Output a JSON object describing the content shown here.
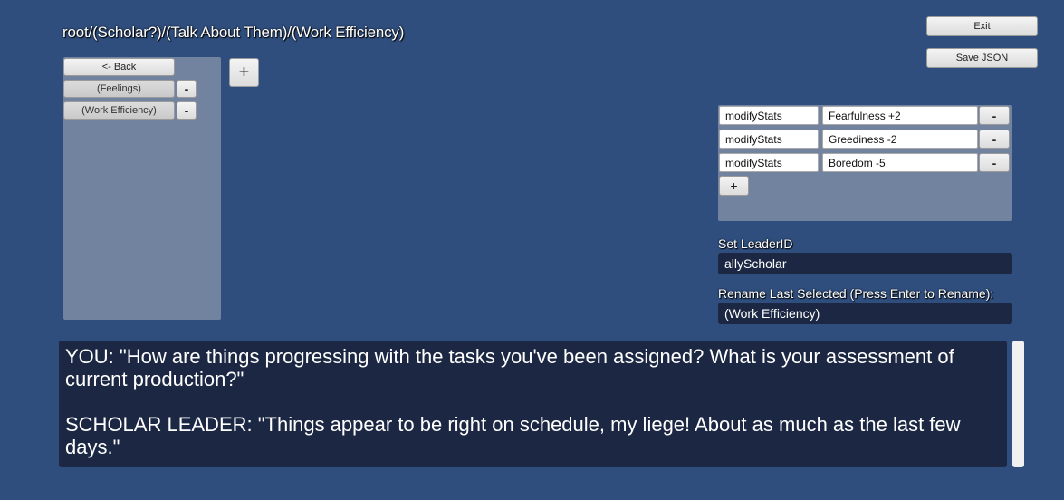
{
  "breadcrumb": "root/(Scholar?)/(Talk About Them)/(Work Efficiency)",
  "toolbar": {
    "exit_label": "Exit",
    "save_json_label": "Save JSON"
  },
  "node_list": {
    "back_label": "<- Back",
    "items": [
      {
        "label": "(Feelings)",
        "remove_label": "-"
      },
      {
        "label": "(Work Efficiency)",
        "remove_label": "-"
      }
    ],
    "add_label": "+"
  },
  "actions": {
    "rows": [
      {
        "type": "modifyStats",
        "value": "Fearfulness +2",
        "remove_label": "-"
      },
      {
        "type": "modifyStats",
        "value": "Greediness -2",
        "remove_label": "-"
      },
      {
        "type": "modifyStats",
        "value": "Boredom -5",
        "remove_label": "-"
      }
    ],
    "add_label": "+"
  },
  "leader": {
    "label": "Set LeaderID",
    "value": "allyScholar"
  },
  "rename": {
    "label": "Rename Last Selected (Press Enter to Rename):",
    "value": "(Work Efficiency)"
  },
  "dialogue": {
    "line1": "YOU: \"How are things progressing with the tasks you've been assigned? What is your assessment of current production?\"",
    "line2": "SCHOLAR LEADER: \"Things appear to be right on schedule, my liege! About as much as the last few days.\""
  }
}
